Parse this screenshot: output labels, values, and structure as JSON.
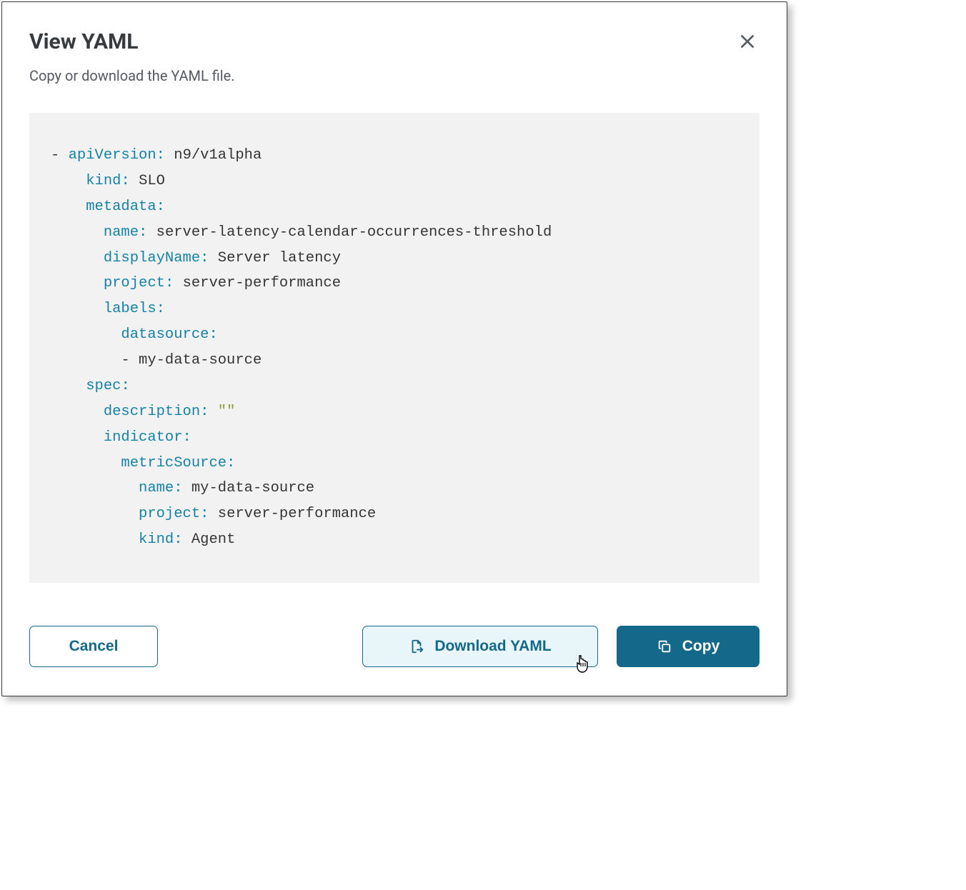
{
  "modal": {
    "title": "View YAML",
    "subtitle": "Copy or download the YAML file."
  },
  "yaml": {
    "lines": [
      {
        "indent": 1,
        "dash": true,
        "key": "apiVersion",
        "value": "n9/v1alpha"
      },
      {
        "indent": 2,
        "key": "kind",
        "value": "SLO"
      },
      {
        "indent": 2,
        "key": "metadata",
        "value": null
      },
      {
        "indent": 3,
        "key": "name",
        "value": "server-latency-calendar-occurrences-threshold"
      },
      {
        "indent": 3,
        "key": "displayName",
        "value": "Server latency"
      },
      {
        "indent": 3,
        "key": "project",
        "value": "server-performance"
      },
      {
        "indent": 3,
        "key": "labels",
        "value": null
      },
      {
        "indent": 4,
        "key": "datasource",
        "value": null
      },
      {
        "indent": 5,
        "dash": true,
        "plain": "my-data-source"
      },
      {
        "indent": 2,
        "key": "spec",
        "value": null
      },
      {
        "indent": 3,
        "key": "description",
        "value": "\"\"",
        "string": true
      },
      {
        "indent": 3,
        "key": "indicator",
        "value": null
      },
      {
        "indent": 4,
        "key": "metricSource",
        "value": null
      },
      {
        "indent": 5,
        "key": "name",
        "value": "my-data-source"
      },
      {
        "indent": 5,
        "key": "project",
        "value": "server-performance"
      },
      {
        "indent": 5,
        "key": "kind",
        "value": "Agent"
      }
    ]
  },
  "buttons": {
    "cancel": "Cancel",
    "download": "Download YAML",
    "copy": "Copy"
  }
}
